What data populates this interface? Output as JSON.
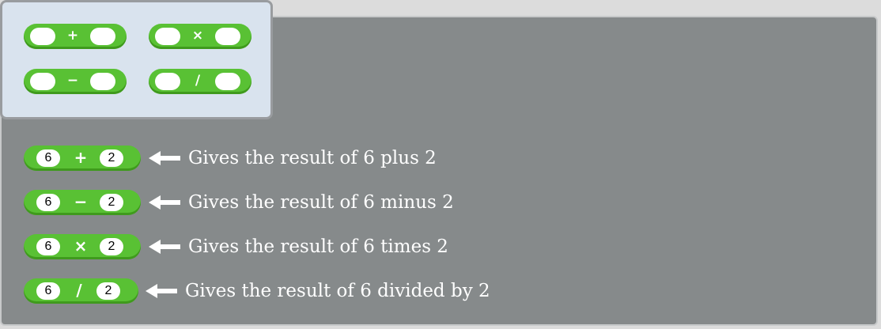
{
  "palette": {
    "blocks": [
      {
        "op": "+"
      },
      {
        "op": "×"
      },
      {
        "op": "−"
      },
      {
        "op": "/"
      }
    ]
  },
  "examples": [
    {
      "left": "6",
      "op": "+",
      "right": "2",
      "description": "Gives the result of 6 plus 2"
    },
    {
      "left": "6",
      "op": "−",
      "right": "2",
      "description": "Gives the result of 6 minus 2"
    },
    {
      "left": "6",
      "op": "×",
      "right": "2",
      "description": "Gives the result of 6 times 2"
    },
    {
      "left": "6",
      "op": "/",
      "right": "2",
      "description": "Gives the result of 6 divided by 2"
    }
  ],
  "colors": {
    "block_green": "#59c134",
    "canvas_gray": "#868a8b",
    "palette_bg": "#d9e3ee"
  }
}
